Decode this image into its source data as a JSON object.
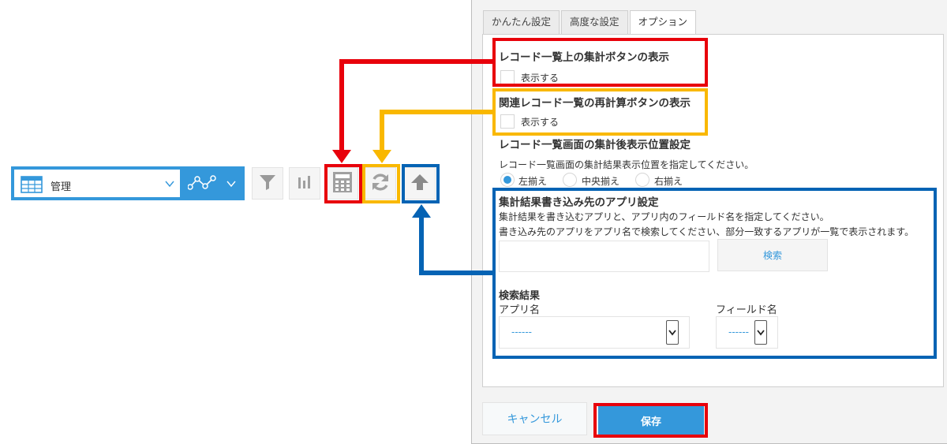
{
  "toolbar": {
    "view_label": "管理",
    "view_chevron": "chevron-down-icon",
    "graph_chevron": "chevron-down-icon",
    "icons": [
      "table-icon",
      "graph-icon",
      "filter-icon",
      "bar-chart-icon",
      "calculator-icon",
      "refresh-icon",
      "upload-arrow-icon"
    ],
    "brand_color": "#3498db"
  },
  "dialog": {
    "tabs": [
      {
        "label": "かんたん設定"
      },
      {
        "label": "高度な設定"
      },
      {
        "label": "オプション"
      }
    ],
    "sections": {
      "aggregate_button": {
        "title": "レコード一覧上の集計ボタンの表示",
        "checkbox_label": "表示する"
      },
      "recalc_button": {
        "title": "関連レコード一覧の再計算ボタンの表示",
        "checkbox_label": "表示する"
      },
      "position": {
        "title": "レコード一覧画面の集計後表示位置設定",
        "description": "レコード一覧画面の集計結果表示位置を指定してください。",
        "options": [
          "左揃え",
          "中央揃え",
          "右揃え"
        ],
        "selected": "左揃え"
      },
      "write_target": {
        "title": "集計結果書き込み先のアプリ設定",
        "desc1": "集計結果を書き込むアプリと、アプリ内のフィールド名を指定してください。",
        "desc2": "書き込み先のアプリをアプリ名で検索してください、部分一致するアプリが一覧で表示されます。",
        "search_input_value": "",
        "search_button": "検索",
        "result_heading": "検索結果",
        "app_name_label": "アプリ名",
        "app_name_value": "------",
        "field_name_label": "フィールド名",
        "field_name_value": "------"
      }
    },
    "cancel_button": "キャンセル",
    "save_button": "保存"
  },
  "highlight_colors": {
    "red": "#e8000b",
    "yellow": "#f9b800",
    "blue": "#0563b4"
  }
}
